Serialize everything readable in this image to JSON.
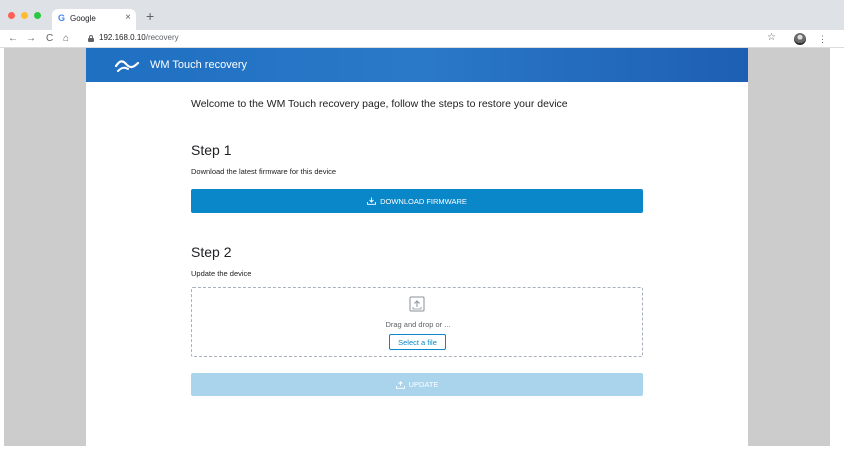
{
  "browser": {
    "tab_title": "Google",
    "tab_favicon": "G",
    "tab_close": "×",
    "new_tab": "+",
    "url_host": "192.168.0.10",
    "url_path": "/recovery",
    "nav_back": "←",
    "nav_forward": "→",
    "nav_reload": "C",
    "nav_home": "⌂",
    "star": "☆",
    "menu": "⋮"
  },
  "header": {
    "title": "WM Touch recovery",
    "logo_icon": "wm-touch-logo"
  },
  "main": {
    "welcome": "Welcome to the WM Touch recovery page, follow the steps to restore your device",
    "step1": {
      "title": "Step 1",
      "description": "Download  the latest firmware for this device",
      "button_label": "DOWNLOAD FIRMWARE",
      "button_icon": "download-icon"
    },
    "step2": {
      "title": "Step 2",
      "description": "Update the device",
      "dropzone_icon": "upload-file-icon",
      "dropzone_text": "Drag and drop or ...",
      "select_label": "Select a file",
      "update_label": "UPDATE",
      "update_icon": "upload-icon"
    }
  },
  "colors": {
    "header_blue": "#1f6fc2",
    "primary_button": "#0a87c9",
    "disabled_button": "#a9d4ec",
    "side_background": "#cccccc"
  }
}
